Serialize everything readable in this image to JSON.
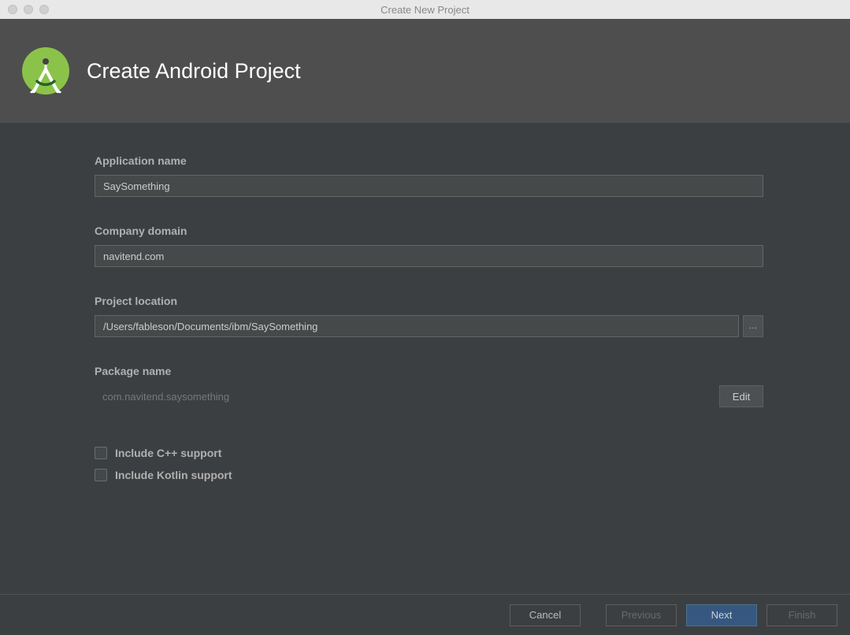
{
  "window": {
    "title": "Create New Project"
  },
  "header": {
    "title": "Create Android Project"
  },
  "form": {
    "app_name": {
      "label": "Application name",
      "value": "SaySomething"
    },
    "company_domain": {
      "label": "Company domain",
      "value": "navitend.com"
    },
    "project_location": {
      "label": "Project location",
      "value": "/Users/fableson/Documents/ibm/SaySomething",
      "browse_label": "…"
    },
    "package_name": {
      "label": "Package name",
      "value": "com.navitend.saysomething",
      "edit_label": "Edit"
    },
    "checkboxes": {
      "cpp": "Include C++ support",
      "kotlin": "Include Kotlin support"
    }
  },
  "footer": {
    "cancel": "Cancel",
    "previous": "Previous",
    "next": "Next",
    "finish": "Finish"
  }
}
